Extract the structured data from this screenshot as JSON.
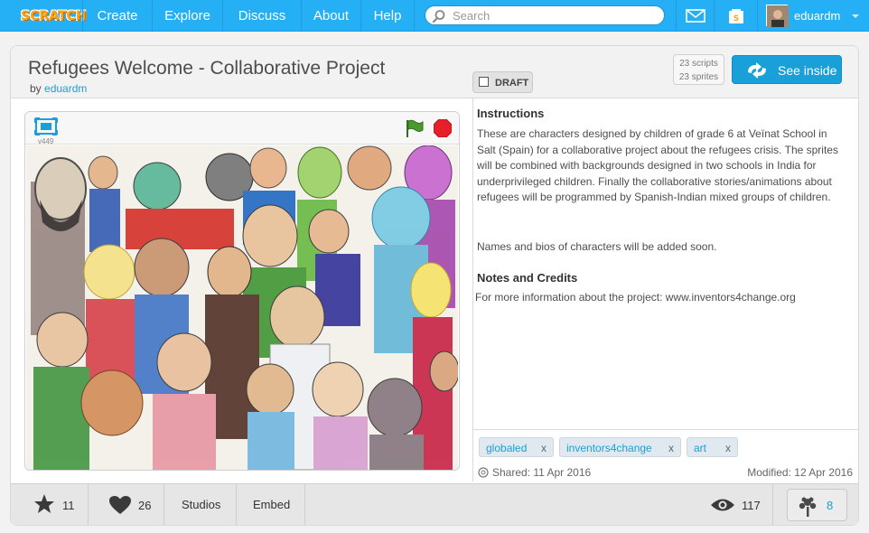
{
  "nav": {
    "logo": "SCRATCH",
    "links": [
      "Create",
      "Explore",
      "Discuss",
      "About",
      "Help"
    ],
    "search_placeholder": "Search",
    "username": "eduardm"
  },
  "project": {
    "title": "Refugees Welcome - Collaborative Project",
    "by_label": "by",
    "author": "eduardm",
    "draft_label": "DRAFT",
    "scripts_count": "23 scripts",
    "sprites_count": "23 sprites",
    "see_inside_label": "See inside",
    "version": "v449"
  },
  "description": {
    "instructions_heading": "Instructions",
    "instructions_p1": "These are characters designed by children of grade 6 at Veïnat School in Salt (Spain) for a collaborative project about the refugees crisis. The sprites will be combined with backgrounds designed in two schools in India for underprivileged children. Finally the collaborative stories/animations about refugees will be programmed by Spanish-Indian mixed groups of children.",
    "instructions_p2": "Names and bios of characters will be added soon.",
    "notes_heading": "Notes and Credits",
    "notes_p1": "For more information about the project: www.inventors4change.org"
  },
  "tags": [
    {
      "label": "globaled",
      "remove": "x"
    },
    {
      "label": "inventors4change",
      "remove": "x"
    },
    {
      "label": "art",
      "remove": "x"
    }
  ],
  "dates": {
    "shared": "Shared: 11 Apr 2016",
    "modified": "Modified: 12 Apr 2016"
  },
  "stats": {
    "favorites": "11",
    "loves": "26",
    "studios_label": "Studios",
    "embed_label": "Embed",
    "views": "117",
    "remixes": "8"
  },
  "icons": {
    "search": "search-icon",
    "messages": "envelope-icon",
    "mystuff": "folder-icon",
    "fullscreen": "fullscreen-icon",
    "green_flag": "green-flag-icon",
    "stop": "stop-icon",
    "star": "star-icon",
    "heart": "heart-icon",
    "views": "eye-icon",
    "remix": "remix-tree-icon"
  },
  "colors": {
    "nav_blue": "#25aff4",
    "link_blue": "#1aa0d8",
    "flag_green": "#4a9a2e",
    "stop_red": "#e5202a"
  }
}
